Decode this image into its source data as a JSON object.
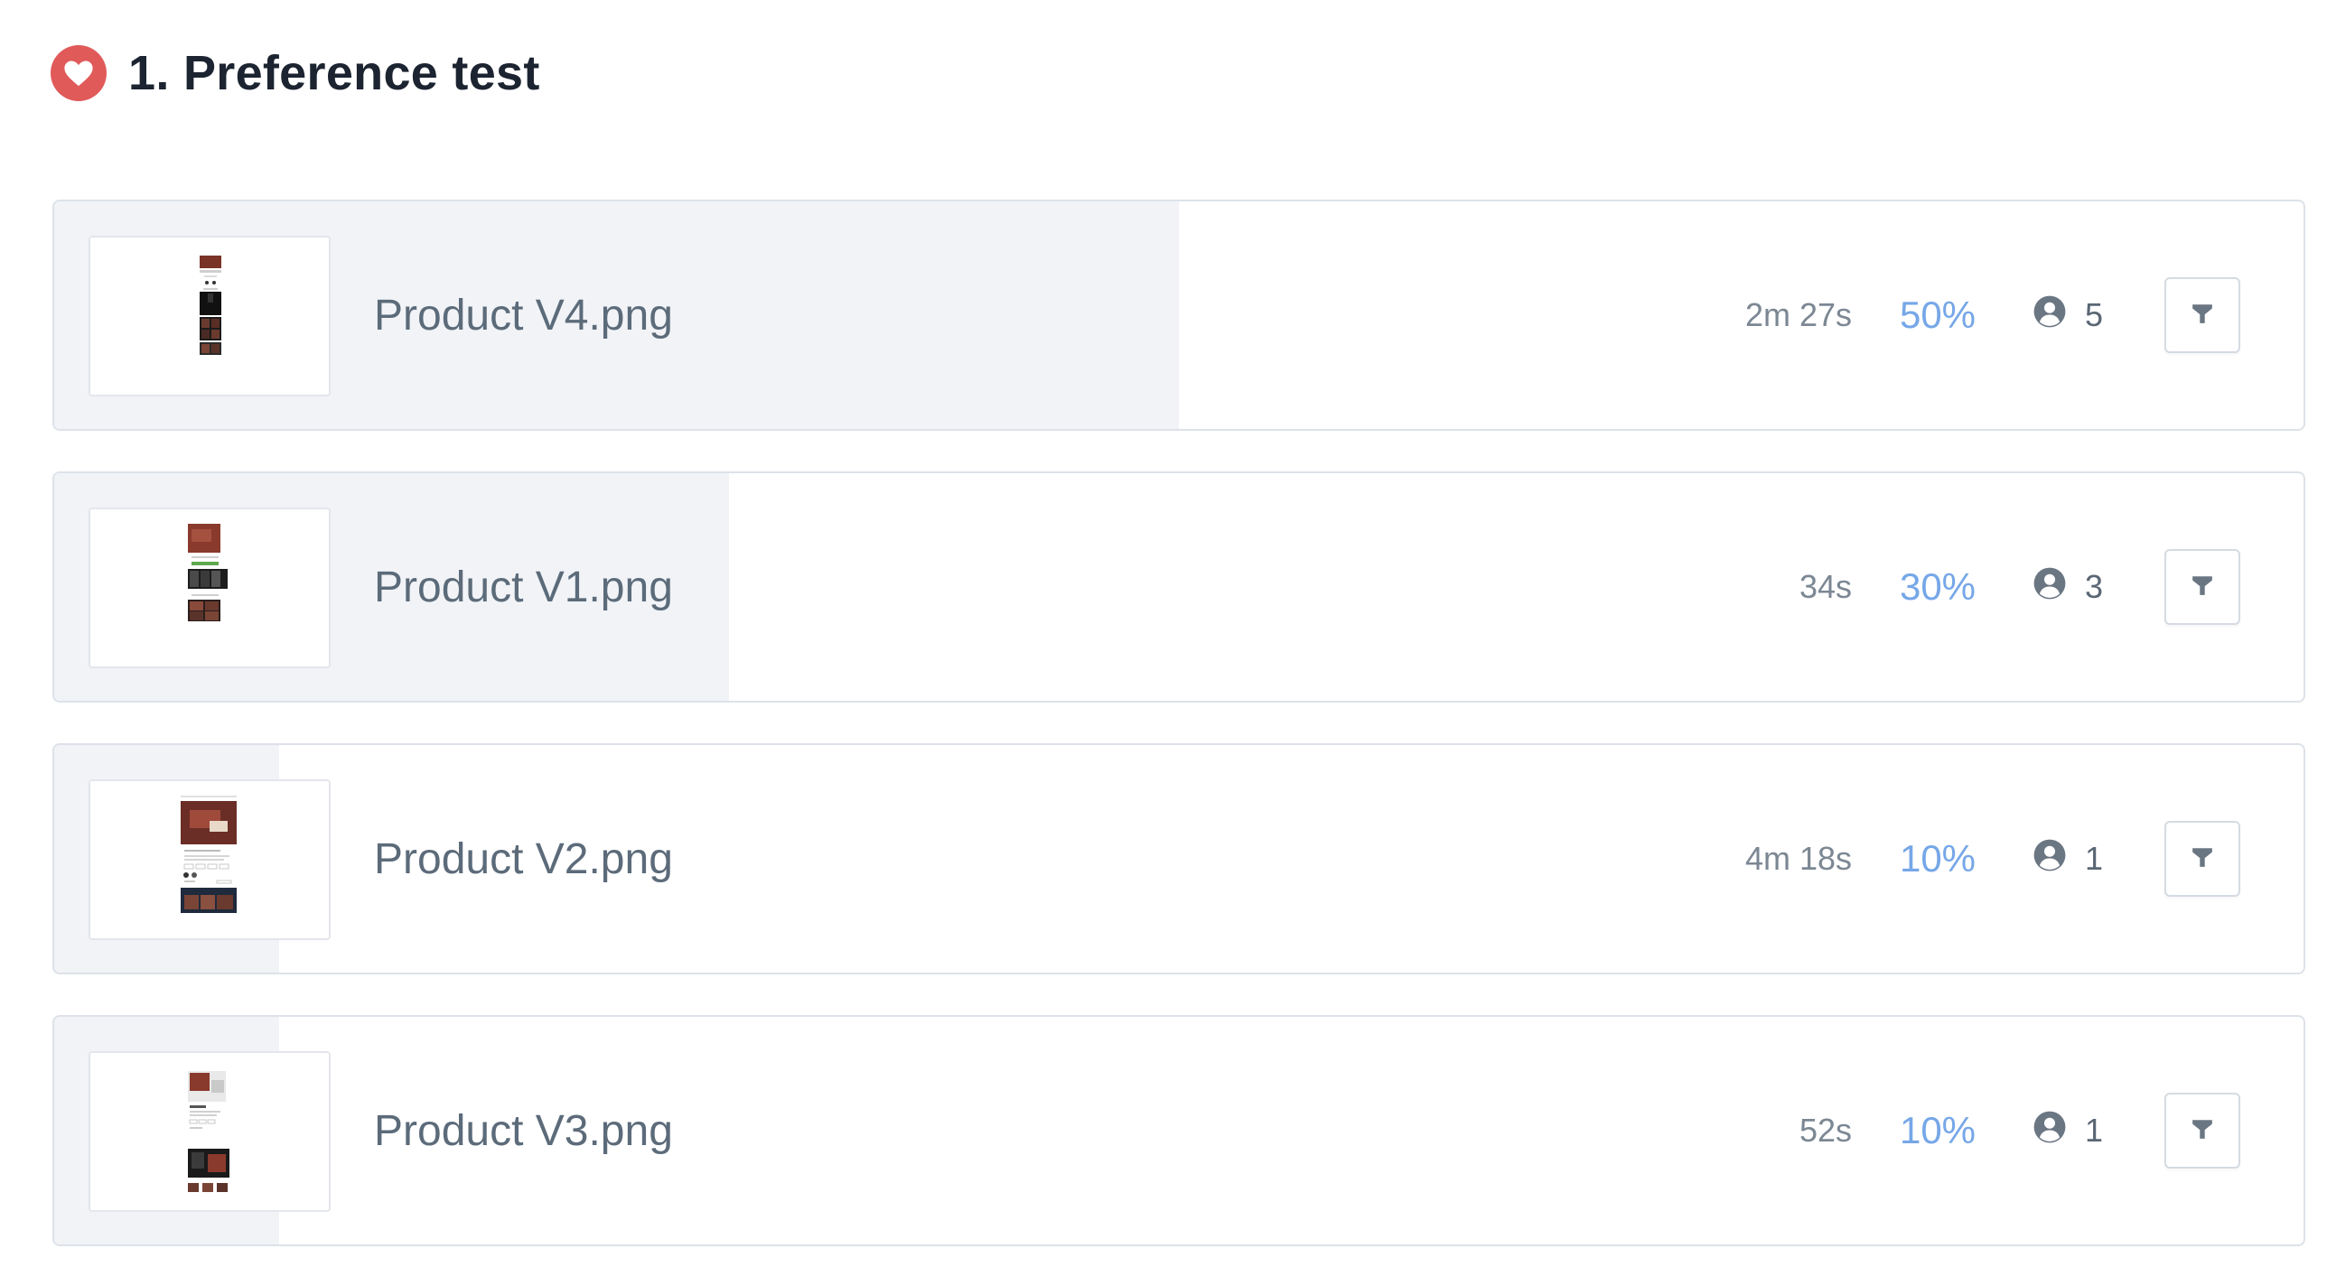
{
  "section": {
    "title": "1. Preference test",
    "icon": "heart-icon",
    "accent_color": "#e05a5a"
  },
  "results": [
    {
      "file": "Product V4.png",
      "avg_time": "2m 27s",
      "percent_label": "50%",
      "share": 0.5,
      "participants": "5"
    },
    {
      "file": "Product V1.png",
      "avg_time": "34s",
      "percent_label": "30%",
      "share": 0.3,
      "participants": "3"
    },
    {
      "file": "Product V2.png",
      "avg_time": "4m 18s",
      "percent_label": "10%",
      "share": 0.1,
      "participants": "1"
    },
    {
      "file": "Product V3.png",
      "avg_time": "52s",
      "percent_label": "10%",
      "share": 0.1,
      "participants": "1"
    }
  ],
  "icons": {
    "participants": "user-circle-icon",
    "filter": "filter-icon"
  },
  "colors": {
    "percent": "#76a7e8",
    "bar_fill": "#f1f3f7"
  }
}
